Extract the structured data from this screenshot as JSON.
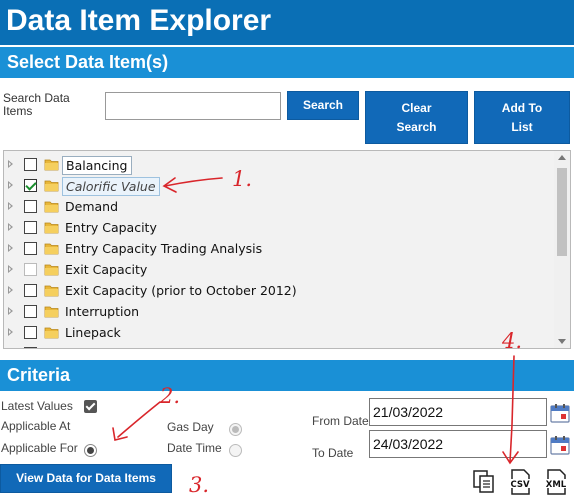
{
  "header": {
    "title": "Data Item Explorer"
  },
  "select_section": {
    "title": "Select Data Item(s)"
  },
  "search": {
    "label": "Search Data Items",
    "value": "",
    "placeholder": "",
    "search_button": "Search",
    "clear_button_line1": "Clear",
    "clear_button_line2": "Search",
    "add_button_line1": "Add To",
    "add_button_line2": "List"
  },
  "tree": {
    "items": [
      {
        "label": "Balancing",
        "checked": false
      },
      {
        "label": "Calorific Value",
        "checked": true
      },
      {
        "label": "Demand",
        "checked": false
      },
      {
        "label": "Entry Capacity",
        "checked": false
      },
      {
        "label": "Entry Capacity Trading Analysis",
        "checked": false
      },
      {
        "label": "Exit Capacity",
        "checked": false
      },
      {
        "label": "Exit Capacity (prior to October 2012)",
        "checked": false
      },
      {
        "label": "Interruption",
        "checked": false
      },
      {
        "label": "Linepack",
        "checked": false
      }
    ]
  },
  "criteria": {
    "title": "Criteria",
    "latest_values": "Latest Values",
    "applicable_at": "Applicable At",
    "applicable_for": "Applicable For",
    "gas_day": "Gas Day",
    "date_time": "Date Time",
    "from_date_label": "From Date",
    "from_date_value": "21/03/2022",
    "to_date_label": "To Date",
    "to_date_value": "24/03/2022",
    "view_button": "View Data for Data Items"
  },
  "export": {
    "csv": "CSV",
    "xml": "XML"
  },
  "annotations": {
    "a1": "1.",
    "a2": "2.",
    "a3": "3.",
    "a4": "4."
  },
  "colors": {
    "title_bar": "#0a6fb5",
    "section_bar": "#1a90d6",
    "button": "#1169b8",
    "annotation": "#d9262b"
  }
}
